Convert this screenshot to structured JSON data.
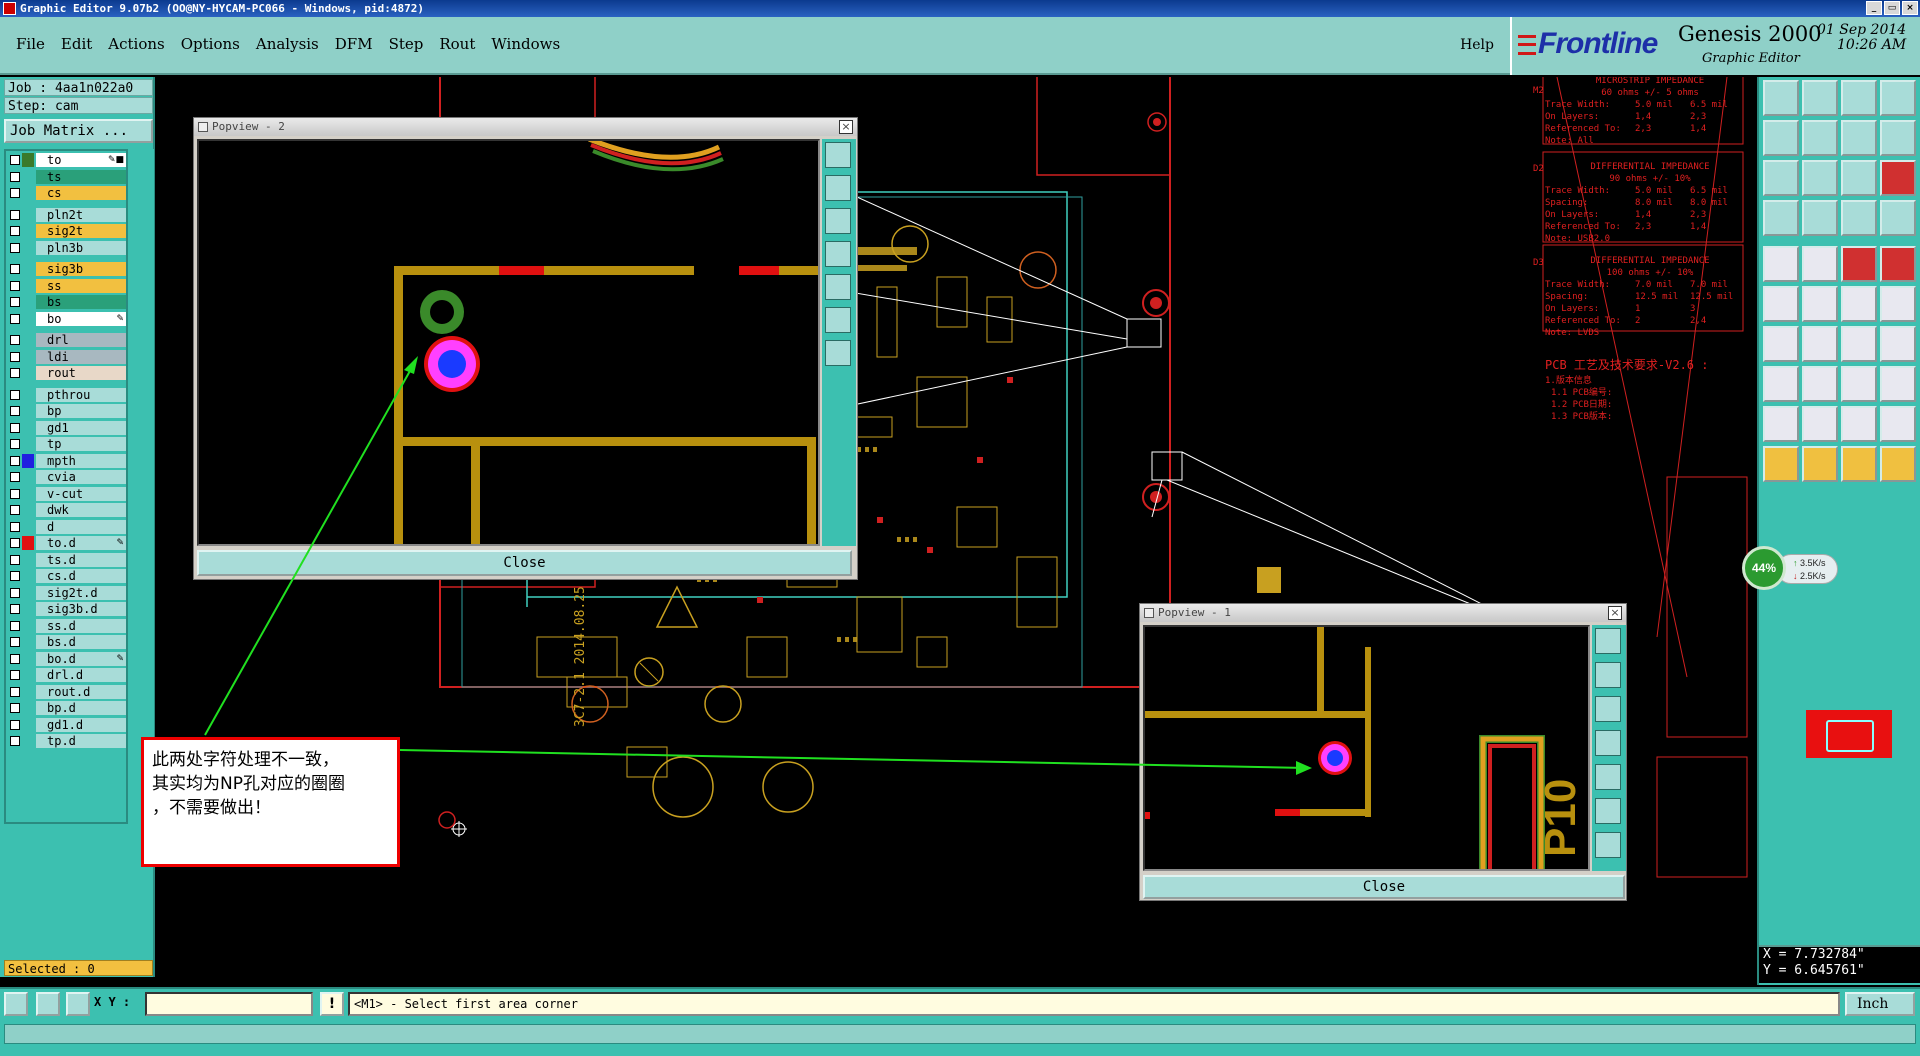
{
  "window": {
    "title": "Graphic Editor 9.07b2 (OO@NY-HYCAM-PC066 - Windows, pid:4872)"
  },
  "menu": {
    "items": [
      "File",
      "Edit",
      "Actions",
      "Options",
      "Analysis",
      "DFM",
      "Step",
      "Rout",
      "Windows"
    ],
    "help": "Help"
  },
  "brand": {
    "logo": "Frontline",
    "product": "Genesis 2000",
    "subtitle": "Graphic Editor",
    "date": "01 Sep 2014",
    "time": "10:26 AM"
  },
  "job": {
    "job_line": "Job : 4aa1n022a0",
    "step_line": "Step: cam",
    "matrix_button": "Job Matrix ..."
  },
  "layers": [
    {
      "name": "to",
      "color": "#ffffff",
      "mark": "✎■",
      "swatch": "#3a7a2a"
    },
    {
      "name": "ts",
      "color": "#2aa07a"
    },
    {
      "name": "cs",
      "color": "#f2c040"
    },
    {
      "name": "pln2t",
      "color": "#a8dcd8"
    },
    {
      "name": "sig2t",
      "color": "#f2c040"
    },
    {
      "name": "pln3b",
      "color": "#a8dcd8"
    },
    {
      "name": "sig3b",
      "color": "#f2c040"
    },
    {
      "name": "ss",
      "color": "#f2c040"
    },
    {
      "name": "bs",
      "color": "#2aa07a"
    },
    {
      "name": "bo",
      "color": "#ffffff",
      "mark": "✎"
    },
    {
      "name": "drl",
      "color": "#a8b8c0"
    },
    {
      "name": "ldi",
      "color": "#a8b8c0"
    },
    {
      "name": "rout",
      "color": "#e8d8c8"
    },
    {
      "name": "pthrou",
      "color": "#a8dcd8"
    },
    {
      "name": "bp",
      "color": "#a8dcd8"
    },
    {
      "name": "gd1",
      "color": "#a8dcd8"
    },
    {
      "name": "tp",
      "color": "#a8dcd8"
    },
    {
      "name": "mpth",
      "color": "#a8dcd8",
      "swatch": "#2020e0"
    },
    {
      "name": "cvia",
      "color": "#a8dcd8"
    },
    {
      "name": "v-cut",
      "color": "#a8dcd8"
    },
    {
      "name": "dwk",
      "color": "#a8dcd8"
    },
    {
      "name": "d",
      "color": "#a8dcd8"
    },
    {
      "name": "to.d",
      "color": "#a8dcd8",
      "swatch": "#e01010",
      "mark": "✎"
    },
    {
      "name": "ts.d",
      "color": "#a8dcd8"
    },
    {
      "name": "cs.d",
      "color": "#a8dcd8"
    },
    {
      "name": "sig2t.d",
      "color": "#a8dcd8"
    },
    {
      "name": "sig3b.d",
      "color": "#a8dcd8"
    },
    {
      "name": "ss.d",
      "color": "#a8dcd8"
    },
    {
      "name": "bs.d",
      "color": "#a8dcd8"
    },
    {
      "name": "bo.d",
      "color": "#a8dcd8",
      "mark": "✎"
    },
    {
      "name": "drl.d",
      "color": "#a8dcd8"
    },
    {
      "name": "rout.d",
      "color": "#a8dcd8"
    },
    {
      "name": "bp.d",
      "color": "#a8dcd8"
    },
    {
      "name": "gd1.d",
      "color": "#a8dcd8"
    },
    {
      "name": "tp.d",
      "color": "#a8dcd8"
    }
  ],
  "selected": "Selected : 0",
  "popup2": {
    "title": "Popview - 2",
    "close": "Close"
  },
  "popup1": {
    "title": "Popview - 1",
    "close": "Close",
    "silk_text": "P10"
  },
  "note": {
    "line1": "此两处字符处理不一致，",
    "line2": "其实均为NP孔对应的圈圈",
    "line3": "，不需要做出！"
  },
  "board_silk": {
    "vertical_text": "3C7-2.1 2014.08.25"
  },
  "spec": {
    "tables": [
      {
        "tag": "M2",
        "title": "MICROSTRIP IMPEDANCE",
        "sub": "60 ohms +/- 5 ohms",
        "rows": [
          [
            "Trace Width:",
            "5.0 mil",
            "6.5 mil"
          ],
          [
            "On Layers:",
            "1,4",
            "2,3"
          ],
          [
            "Referenced To:",
            "2,3",
            "1,4"
          ],
          [
            "Note: All",
            "",
            ""
          ]
        ]
      },
      {
        "tag": "D2",
        "title": "DIFFERENTIAL IMPEDANCE",
        "sub": "90 ohms +/- 10%",
        "rows": [
          [
            "Trace Width:",
            "5.0 mil",
            "6.5 mil"
          ],
          [
            "Spacing:",
            "8.0 mil",
            "8.0 mil"
          ],
          [
            "On Layers:",
            "1,4",
            "2,3"
          ],
          [
            "Referenced To:",
            "2,3",
            "1,4"
          ],
          [
            "Note: USB2.0",
            "",
            ""
          ]
        ]
      },
      {
        "tag": "D3",
        "title": "DIFFERENTIAL IMPEDANCE",
        "sub": "100 ohms +/- 10%",
        "rows": [
          [
            "Trace Width:",
            "7.0 mil",
            "7.0 mil"
          ],
          [
            "Spacing:",
            "12.5 mil",
            "12.5 mil"
          ],
          [
            "On Layers:",
            "1",
            "3"
          ],
          [
            "Referenced To:",
            "2",
            "2,4"
          ],
          [
            "Note: LVDS",
            "",
            ""
          ]
        ]
      }
    ],
    "heading": "PCB 工艺及技术要求-V2.6 :",
    "lines": [
      "1.版本信息",
      "1.1 PCB编号:",
      "1.2 PCB日期:",
      "1.3 PCB版本:"
    ]
  },
  "speed": {
    "percent": "44%",
    "up": "3.5K/s",
    "down": "2.5K/s"
  },
  "coords": {
    "x": "X = 7.732784\"",
    "y": "Y = 6.645761\""
  },
  "cmd": {
    "xy_label": "X Y :",
    "xy_value": "",
    "prompt": "<M1> - Select first area corner",
    "units": "Inch"
  }
}
